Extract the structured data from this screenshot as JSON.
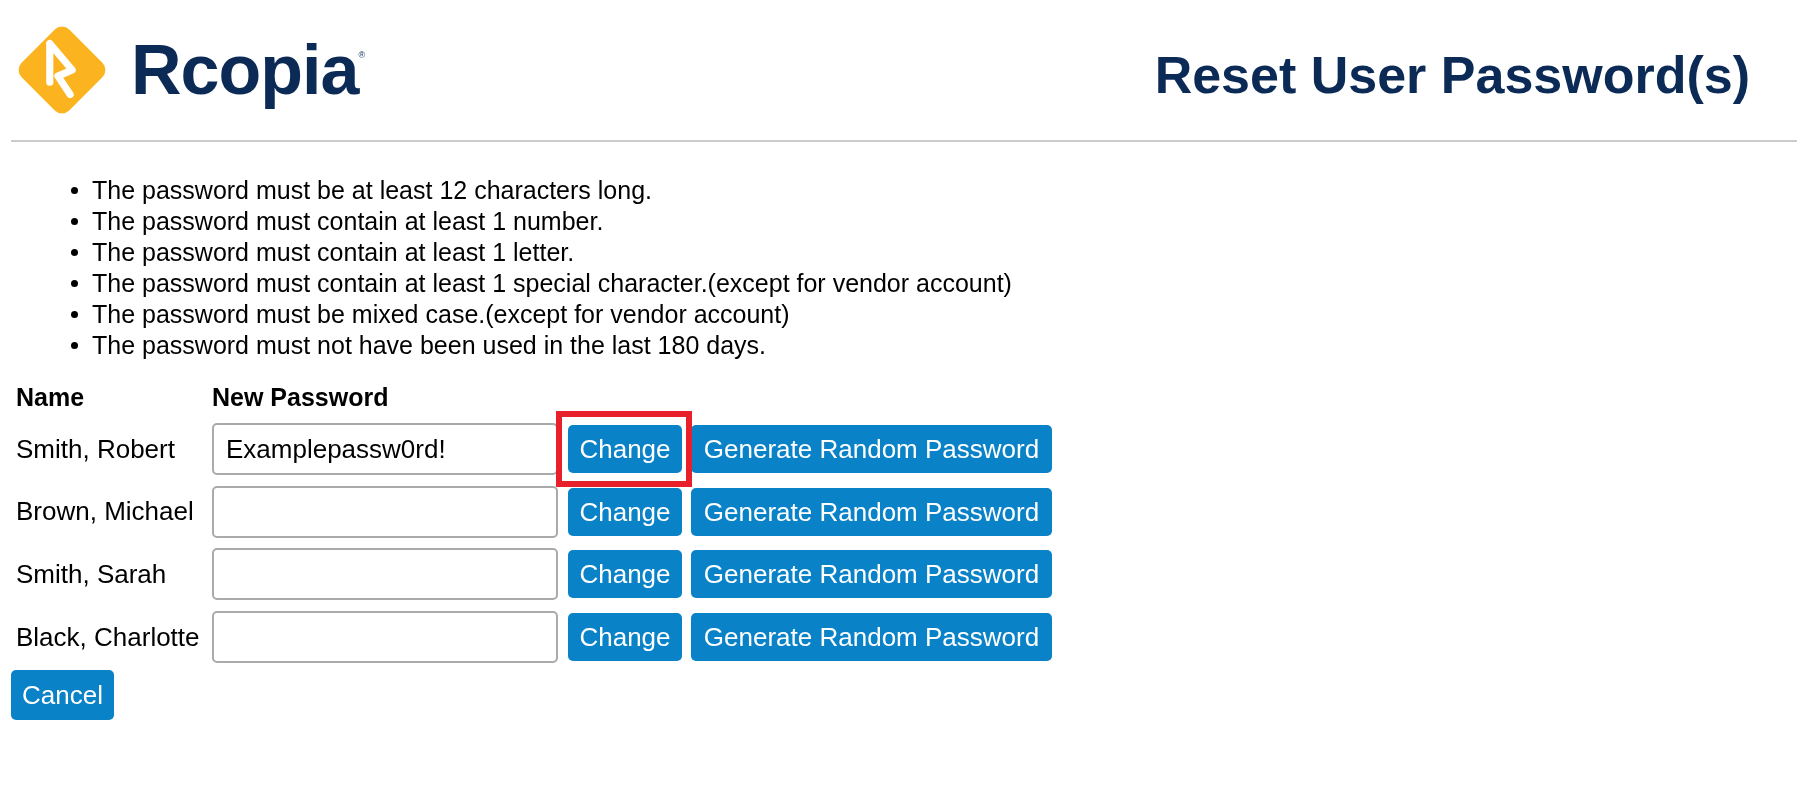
{
  "header": {
    "logo_text": "Rcopia",
    "logo_mark": "®",
    "title": "Reset User Password(s)"
  },
  "rules": [
    "The password must be at least 12 characters long.",
    "The password must contain at least 1 number.",
    "The password must contain at least 1 letter.",
    "The password must contain at least 1 special character.(except for vendor account)",
    "The password must be mixed case.(except for vendor account)",
    "The password must not have been used in the last 180 days."
  ],
  "table": {
    "columns": [
      "Name",
      "New Password"
    ],
    "rows": [
      {
        "name": "Smith, Robert",
        "password": "Examplepassw0rd!",
        "change_label": "Change",
        "generate_label": "Generate Random Password",
        "highlighted": true
      },
      {
        "name": "Brown, Michael",
        "change_label": "Change",
        "generate_label": "Generate Random Password",
        "highlighted": false
      },
      {
        "name": "Smith, Sarah",
        "change_label": "Change",
        "generate_label": "Generate Random Password",
        "highlighted": false
      },
      {
        "name": "Black, Charlotte",
        "change_label": "Change",
        "generate_label": "Generate Random Password",
        "highlighted": false
      }
    ]
  },
  "cancel_label": "Cancel"
}
